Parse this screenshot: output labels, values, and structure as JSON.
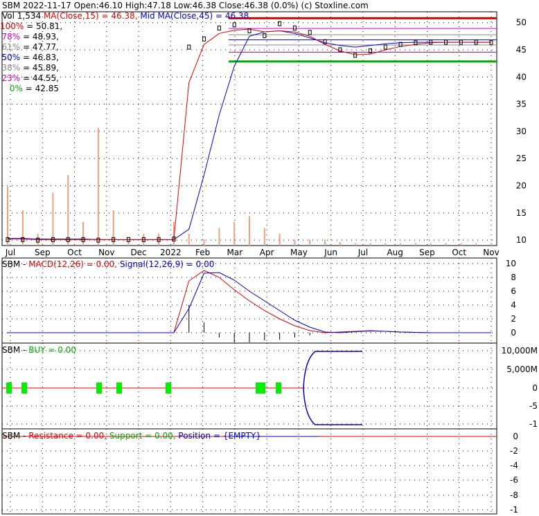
{
  "symbol": "SBM",
  "date": "2022-11-17",
  "open_label": "Open:",
  "open": "46.10",
  "high_label": "High:",
  "high": "47.18",
  "low_label": "Low:",
  "low": "46.38",
  "close_label": "Close:",
  "close": "46.38 (0.0%)",
  "copyright": "(c) Stoxline.com",
  "vol_label": "Vol 1,534",
  "ma_label": "MA(Close,15) = 46.38,",
  "midma_label": "Mid MA(Close,45) = 46.38,",
  "fib_levels": [
    {
      "pct": "100%",
      "value": "= 50.81,",
      "color": "#e00000"
    },
    {
      "pct": "78%",
      "value": "= 48.93,",
      "color": "#cc00cc"
    },
    {
      "pct": "61%",
      "value": "= 47.77,",
      "color": "#888888"
    },
    {
      "pct": "50%",
      "value": "= 46.83,",
      "color": "#0000cc"
    },
    {
      "pct": "38%",
      "value": "= 45.89,",
      "color": "#888888"
    },
    {
      "pct": "23%",
      "value": "= 44.55,",
      "color": "#cc00cc"
    },
    {
      "pct": "0%",
      "value": "= 42.85",
      "color": "#00aa00"
    }
  ],
  "macd_panel": {
    "name": "MACD(12,26) = 0.00,",
    "signal": "Signal(12,26,9) = 0.00"
  },
  "buy_panel": {
    "name": "BUY = 0.00"
  },
  "res_panel": {
    "resistance": "Resistance = 0.00,",
    "support": "Support = 0.00,",
    "position": "Position = {EMPTY}"
  },
  "colors": {
    "price": "#000000",
    "ma15": "#e00000",
    "ma45": "#0000cc",
    "volume": "#f0a080",
    "buy_marker": "#00ee00",
    "grid": "#000000"
  },
  "chart_data": [
    {
      "type": "line",
      "panel": "price",
      "x_labels": [
        "Jul",
        "Sep",
        "Oct",
        "Nov",
        "Dec",
        "2022",
        "Feb",
        "Mar",
        "Apr",
        "May",
        "Jun",
        "Jul",
        "Aug",
        "Sep",
        "Oct",
        "Nov"
      ],
      "y_ticks": [
        10,
        15,
        20,
        25,
        30,
        35,
        40,
        45,
        50
      ],
      "ylim": [
        9,
        52
      ],
      "close": [
        10.1,
        10.1,
        10.0,
        10.1,
        10.1,
        10.1,
        10.0,
        10.1,
        10.1,
        10.1,
        10.1,
        10.2,
        45.5,
        47.0,
        49.0,
        49.6,
        48.5,
        47.6,
        49.8,
        49.0,
        48.2,
        46.5,
        45.0,
        44.0,
        44.8,
        45.5,
        46.0,
        46.3,
        46.4,
        46.4,
        46.4,
        46.4,
        46.38
      ],
      "ma15": [
        10.2,
        10.2,
        10.1,
        10.1,
        10.1,
        10.1,
        10.1,
        10.1,
        10.1,
        10.1,
        10.1,
        10.1,
        39.0,
        46.0,
        48.0,
        48.6,
        48.8,
        48.3,
        48.5,
        48.3,
        47.5,
        46.0,
        44.8,
        44.1,
        44.2,
        45.0,
        45.6,
        46.0,
        46.3,
        46.38,
        46.38,
        46.38,
        46.38
      ],
      "ma45": [
        10.3,
        10.3,
        10.2,
        10.2,
        10.2,
        10.2,
        10.1,
        10.1,
        10.1,
        10.1,
        10.1,
        10.1,
        12.0,
        22.0,
        33.0,
        42.0,
        47.5,
        48.3,
        48.5,
        48.0,
        47.2,
        46.3,
        45.8,
        45.5,
        45.8,
        46.1,
        46.3,
        46.38,
        46.38,
        46.38,
        46.38,
        46.38,
        46.38
      ],
      "volume_relative": [
        0.5,
        0.3,
        0.1,
        0.45,
        0.6,
        0.2,
        1.0,
        0.3,
        0.05,
        0.1,
        0.1,
        0.2,
        0.1,
        0.05,
        0.15,
        0.2,
        0.25,
        0.15,
        0.1,
        0.05,
        0.05,
        0.05,
        0.03,
        0.02,
        0.02,
        0.02,
        0.02,
        0.02,
        0.02,
        0.02,
        0.02,
        0.02,
        0.02
      ]
    },
    {
      "type": "line",
      "panel": "macd",
      "y_ticks": [
        10,
        8,
        6,
        4,
        2,
        0
      ],
      "ylim": [
        -1.5,
        10.8
      ],
      "macd": [
        0,
        0,
        0,
        0,
        0,
        0,
        0,
        0,
        0,
        0,
        0,
        0,
        7.5,
        9.0,
        8.0,
        6.2,
        4.6,
        3.2,
        2.0,
        1.0,
        0.3,
        0.0,
        0.1,
        0.2,
        0.3,
        0.2,
        0.1,
        0.05,
        0.0,
        0.0,
        0.0,
        0.0,
        0.0
      ],
      "signal": [
        0,
        0,
        0,
        0,
        0,
        0,
        0,
        0,
        0,
        0,
        0,
        0,
        3.5,
        8.6,
        8.7,
        7.6,
        6.0,
        4.6,
        3.2,
        1.8,
        0.8,
        0.1,
        0.0,
        0.15,
        0.25,
        0.2,
        0.1,
        0.05,
        0.0,
        0.0,
        0.0,
        0.0,
        0.0
      ],
      "histogram": [
        0,
        0,
        0,
        0,
        0,
        0,
        0,
        0,
        0,
        0,
        0,
        0,
        4.0,
        1.5,
        -0.7,
        -1.4,
        -1.4,
        -1.1,
        -1.0,
        -0.7,
        -0.4,
        -0.1,
        0.1,
        0.05,
        0.05,
        0.0,
        0.0,
        0.0,
        0.0,
        0.0,
        0.0,
        0.0,
        0.0
      ]
    },
    {
      "type": "line",
      "panel": "buy",
      "y_ticks": [
        "10,000M",
        "5,000M",
        "0",
        "-5",
        "-1"
      ],
      "buy_marker_dates": [
        "Jul",
        "Jul",
        "Oct",
        "Oct",
        "Dec",
        "Apr",
        "Apr",
        "Apr"
      ]
    },
    {
      "type": "line",
      "panel": "resistance",
      "y_ticks": [
        0,
        -2,
        -4,
        -6,
        -8,
        -1
      ],
      "resistance": 0.0,
      "support": 0.0
    }
  ]
}
